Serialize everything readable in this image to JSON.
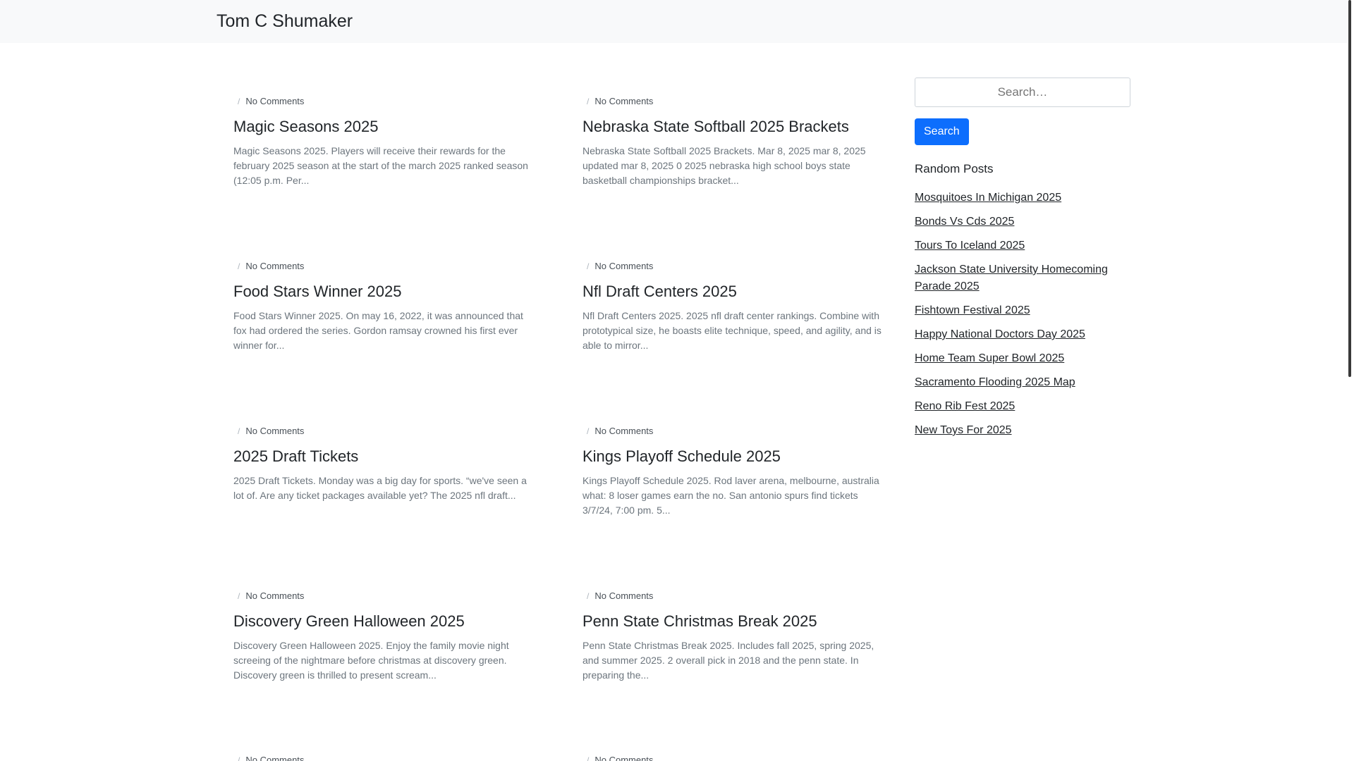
{
  "site": {
    "title": "Tom C Shumaker"
  },
  "posts": [
    {
      "meta": "No Comments",
      "title": "Magic Seasons 2025",
      "excerpt": "Magic Seasons 2025. Players will receive their rewards for the february 2025 season at the start of the march 2025 ranked season (12:05 p.m. Per..."
    },
    {
      "meta": "No Comments",
      "title": "Nebraska State Softball 2025 Brackets",
      "excerpt": "Nebraska State Softball 2025 Brackets. Mar 8, 2025 mar 8, 2025 updated mar 8, 2025 0 2025 nebraska high school boys state basketball championships bracket..."
    },
    {
      "meta": "No Comments",
      "title": "Food Stars Winner 2025",
      "excerpt": "Food Stars Winner 2025. On may 16, 2022, it was announced that fox had ordered the series. Gordon ramsay crowned his first ever winner for..."
    },
    {
      "meta": "No Comments",
      "title": "Nfl Draft Centers 2025",
      "excerpt": "Nfl Draft Centers 2025. 2025 nfl draft center rankings. Combine with prototypical size, he boasts elite technique, speed, and agility, and is able to mirror..."
    },
    {
      "meta": "No Comments",
      "title": "2025 Draft Tickets",
      "excerpt": "2025 Draft Tickets. Monday was a big day for sports. “we've seen a lot of. Are any ticket packages available yet? The 2025 nfl draft..."
    },
    {
      "meta": "No Comments",
      "title": "Kings Playoff Schedule 2025",
      "excerpt": "Kings Playoff Schedule 2025. Rod laver arena, melbourne, australia what: 8 loser games earn the no. San antonio spurs find tickets 3/7/24, 7:00 pm. 5..."
    },
    {
      "meta": "No Comments",
      "title": "Discovery Green Halloween 2025",
      "excerpt": "Discovery Green Halloween 2025. Enjoy the family movie night screeing of the nightmare before christmas at discovery green. Discovery green is thrilled to present scream..."
    },
    {
      "meta": "No Comments",
      "title": "Penn State Christmas Break 2025",
      "excerpt": "Penn State Christmas Break 2025. Includes fall 2025, spring 2025, and summer 2025. 2 overall pick in 2018 and the penn state. In preparing the..."
    },
    {
      "meta": "No Comments",
      "title": "",
      "excerpt": ""
    },
    {
      "meta": "No Comments",
      "title": "",
      "excerpt": ""
    }
  ],
  "sidebar": {
    "search_placeholder": "Search…",
    "search_button": "Search",
    "random_title": "Random Posts",
    "random_posts": [
      "Mosquitoes In Michigan 2025",
      "Bonds Vs Cds 2025",
      "Tours To Iceland 2025",
      "Jackson State University Homecoming Parade 2025",
      "Fishtown Festival 2025",
      "Happy National Doctors Day 2025",
      "Home Team Super Bowl 2025",
      "Sacramento Flooding 2025 Map",
      "Reno Rib Fest 2025",
      "New Toys For 2025"
    ]
  }
}
